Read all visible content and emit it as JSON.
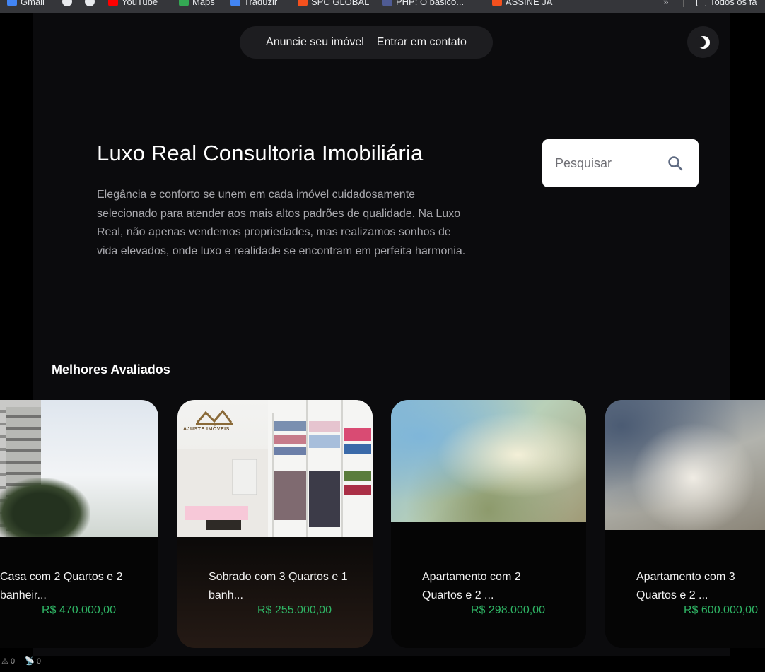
{
  "bookmarks": [
    {
      "label": "Gmail",
      "icon": "gmail-icon",
      "color": "#4285f4"
    },
    {
      "label": "",
      "icon": "circle-icon",
      "color": "#e8eaed"
    },
    {
      "label": "",
      "icon": "circle-icon",
      "color": "#e8eaed"
    },
    {
      "label": "YouTube",
      "icon": "youtube-icon",
      "color": "#ff0000"
    },
    {
      "label": "Maps",
      "icon": "maps-icon",
      "color": "#34a853"
    },
    {
      "label": "Traduzir",
      "icon": "translate-icon",
      "color": "#4285f4"
    },
    {
      "label": "SPC GLOBAL",
      "icon": "spc-icon",
      "color": "#f4511e"
    },
    {
      "label": "PHP: O básico...",
      "icon": "php-icon",
      "color": "#4f5b93"
    },
    {
      "label": "ASSINE JA",
      "icon": "assine-icon",
      "color": "#f4511e"
    }
  ],
  "bookmarks_overflow": "»",
  "bookmarks_all": "Todos os fa",
  "nav": {
    "announce": "Anuncie seu imóvel",
    "contact": "Entrar em contato"
  },
  "hero": {
    "title": "Luxo Real Consultoria Imobiliária",
    "description": "Elegância e conforto se unem em cada imóvel cuidadosamente selecionado para atender aos mais altos padrões de qualidade. Na Luxo Real, não apenas vendemos propriedades, mas realizamos sonhos de vida elevados, onde luxo e realidade se encontram em perfeita harmonia."
  },
  "search": {
    "placeholder": "Pesquisar"
  },
  "section": {
    "title": "Melhores Avaliados"
  },
  "cards": [
    {
      "title": "Casa com 2 Quartos e 2 banheir...",
      "price": "R$ 470.000,00"
    },
    {
      "title": "Sobrado com 3 Quartos e 1 banh...",
      "price": "R$ 255.000,00"
    },
    {
      "title": "Apartamento com 2 Quartos e 2 ...",
      "price": "R$ 298.000,00"
    },
    {
      "title": "Apartamento com 3 Quartos e 2 ...",
      "price": "R$ 600.000,00"
    }
  ],
  "closet_logo": "AJUSTE IMÓVEIS",
  "status": {
    "warnings": "0",
    "broadcast": "0"
  },
  "colors": {
    "page_bg": "#0b0b0d",
    "price": "#2fb565",
    "pill_bg": "#1d1d20"
  }
}
